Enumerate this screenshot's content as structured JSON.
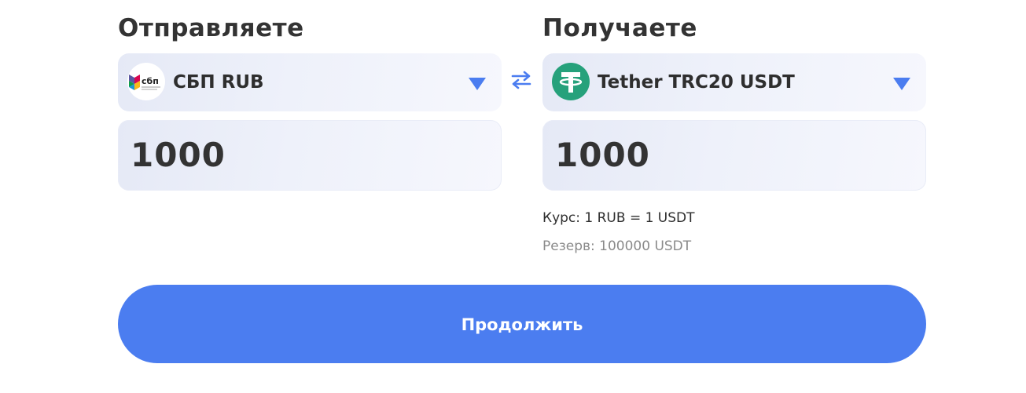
{
  "send": {
    "title": "Отправляете",
    "currency": {
      "label": "СБП RUB",
      "icon": "sbp-logo-icon"
    },
    "amount": "1000"
  },
  "receive": {
    "title": "Получаете",
    "currency": {
      "label": "Tether TRC20 USDT",
      "icon": "tether-logo-icon"
    },
    "amount": "1000"
  },
  "swap": {
    "icon": "swap-arrows-icon"
  },
  "rate_text": "Курс: 1 RUB = 1 USDT",
  "reserve_text": "Резерв: 100000 USDT",
  "continue_label": "Продолжить",
  "colors": {
    "accent": "#4b7df0",
    "tether_green": "#26a17b",
    "field_bg": "#eef1fa",
    "text_dark": "#333333",
    "text_muted": "#8a8a8a"
  }
}
